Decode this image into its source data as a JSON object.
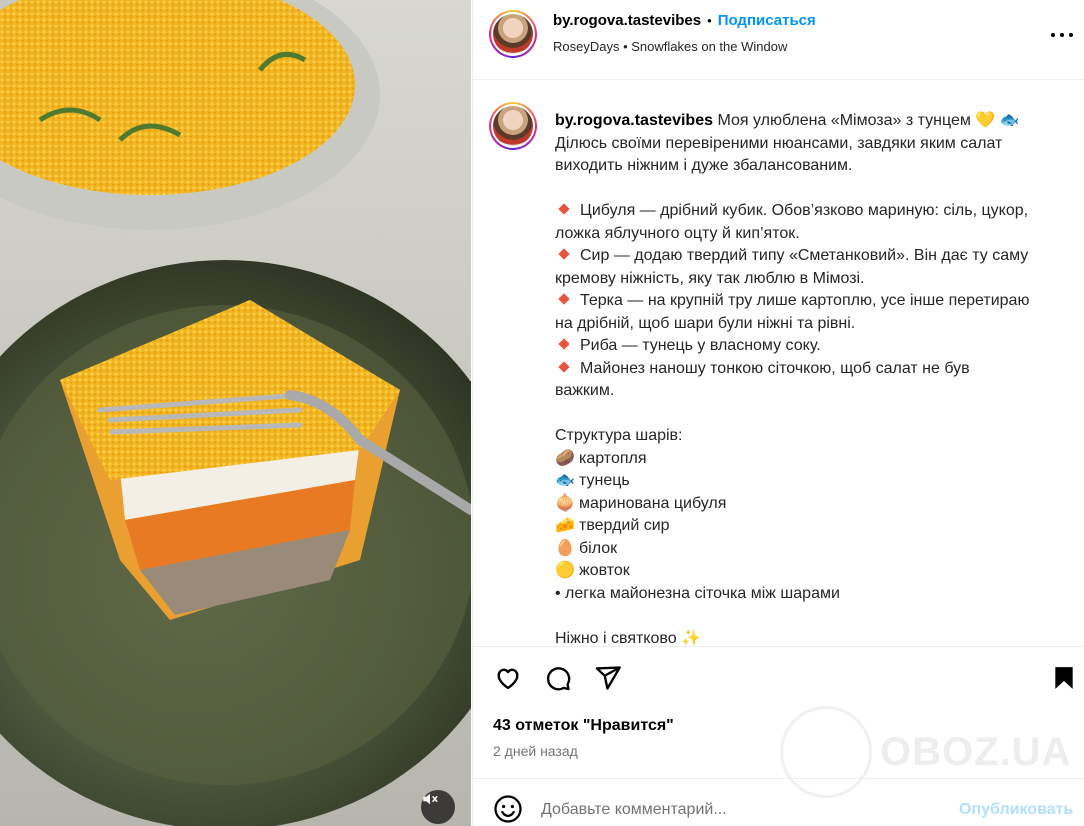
{
  "post": {
    "author": {
      "username": "by.rogova.tastevibes",
      "follow_label": "Подписаться",
      "audio_artist": "RoseyDays",
      "audio_track": "Snowflakes on the Window"
    },
    "caption": {
      "intro": "Моя улюблена «Мімоза» з тунцем",
      "intro_emojis": "💛 🐟",
      "line2": "Ділюсь своїми перевіреними нюансами, завдяки яким салат",
      "line3": "виходить ніжним і дуже збалансованим.",
      "tips": [
        {
          "a": "Цибуля — дрібний кубик. Обов’язково мариную: сіль, цукор,",
          "b": "ложка яблучного оцту й кип’яток."
        },
        {
          "a": "Сир — додаю твердий типу «Сметанковий». Він дає ту саму",
          "b": "кремову ніжність, яку так люблю в Мімозі."
        },
        {
          "a": "Терка — на крупній тру лише картоплю, усе інше перетираю",
          "b": "на дрібній, щоб шари були ніжні та рівні."
        },
        {
          "a": "Риба — тунець у власному соку.",
          "b": ""
        },
        {
          "a": "Майонез наношу тонкою сіточкою, щоб салат не був",
          "b": "важким."
        }
      ],
      "structure_title": "Структура шарів:",
      "layers": [
        {
          "emoji": "🥔",
          "label": "картопля"
        },
        {
          "emoji": "🐟",
          "label": "тунець"
        },
        {
          "emoji": "🧅",
          "label": "маринована цибуля"
        },
        {
          "emoji": "🧀",
          "label": "твердий сир"
        },
        {
          "emoji": "🥚",
          "label": "білок"
        },
        {
          "emoji": "🟡",
          "label": "жовток"
        }
      ],
      "mesh_line": "• легка майонезна сіточка між шарами",
      "closing": "Ніжно і святково",
      "closing_emoji": "✨"
    },
    "likes": "43 отметок \"Нравится\"",
    "time_ago": "2 дней назад",
    "comment": {
      "placeholder": "Добавьте комментарий...",
      "publish_label": "Опубликовать"
    },
    "watermark": "OBOZ.UA",
    "icons": {
      "like": "heart-icon",
      "comment": "comment-icon",
      "share": "send-icon",
      "save": "bookmark-icon",
      "emoji": "smiley-icon",
      "mute": "muted-speaker-icon",
      "more": "more-options-icon"
    }
  }
}
